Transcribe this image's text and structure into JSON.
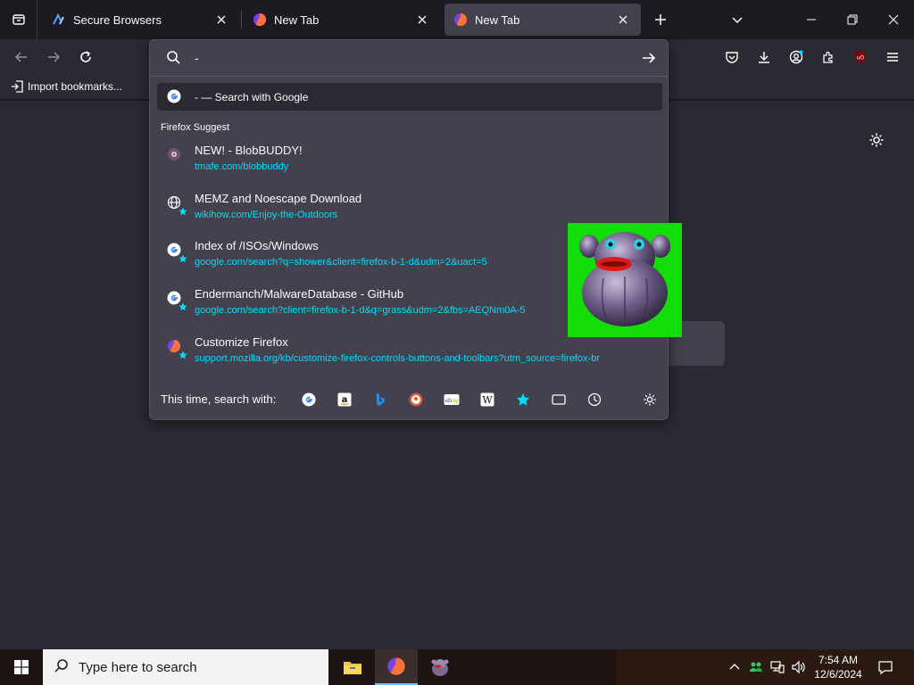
{
  "window": {
    "tabs": [
      {
        "title": "Secure Browsers",
        "icon": "secure-browsers-favicon"
      },
      {
        "title": "New Tab",
        "icon": "firefox-icon"
      },
      {
        "title": "New Tab",
        "icon": "firefox-icon",
        "selected": true
      }
    ],
    "new_tab_icon": "plus-icon",
    "tab_list_icon": "chevron-down-icon"
  },
  "bookmarks": {
    "import_label": "Import bookmarks..."
  },
  "urlbar": {
    "query": "-",
    "heuristic": {
      "title": "-  — Search with Google"
    },
    "group_label": "Firefox Suggest",
    "results": [
      {
        "title": "NEW! - BlobBUDDY!",
        "url": "tmafe.com/blobbuddy",
        "icon": "blobbuddy-favicon"
      },
      {
        "title": "MEMZ and Noescape Download",
        "url": "wikihow.com/Enjoy-the-Outdoors",
        "icon": "globe-bookmark-icon"
      },
      {
        "title": "Index of /ISOs/Windows",
        "url": "google.com/search?q=shower&client=firefox-b-1-d&udm=2&uact=5",
        "icon": "google-bookmark-icon"
      },
      {
        "title": "Endermanch/MalwareDatabase - GitHub",
        "url": "google.com/search?client=firefox-b-1-d&q=grass&udm=2&fbs=AEQNm0A-5",
        "icon": "google-bookmark-icon"
      },
      {
        "title": "Customize Firefox",
        "url": "support.mozilla.org/kb/customize-firefox-controls-buttons-and-toolbars?utm_source=firefox-br",
        "icon": "firefox-bookmark-icon"
      }
    ],
    "oneoff_label": "This time, search with:",
    "engines": [
      "google-icon",
      "amazon-icon",
      "bing-icon",
      "duckduckgo-icon",
      "ebay-icon",
      "wikipedia-icon",
      "bookmarks-star-icon",
      "tabs-icon",
      "history-icon"
    ]
  },
  "taskbar": {
    "search_placeholder": "Type here to search",
    "time": "7:54 AM",
    "date": "12/6/2024"
  },
  "colors": {
    "accent_link": "#00ddff",
    "urlbar_bg": "#42414d",
    "content_bg": "#2b2a33",
    "green_screen": "#13dd06"
  }
}
